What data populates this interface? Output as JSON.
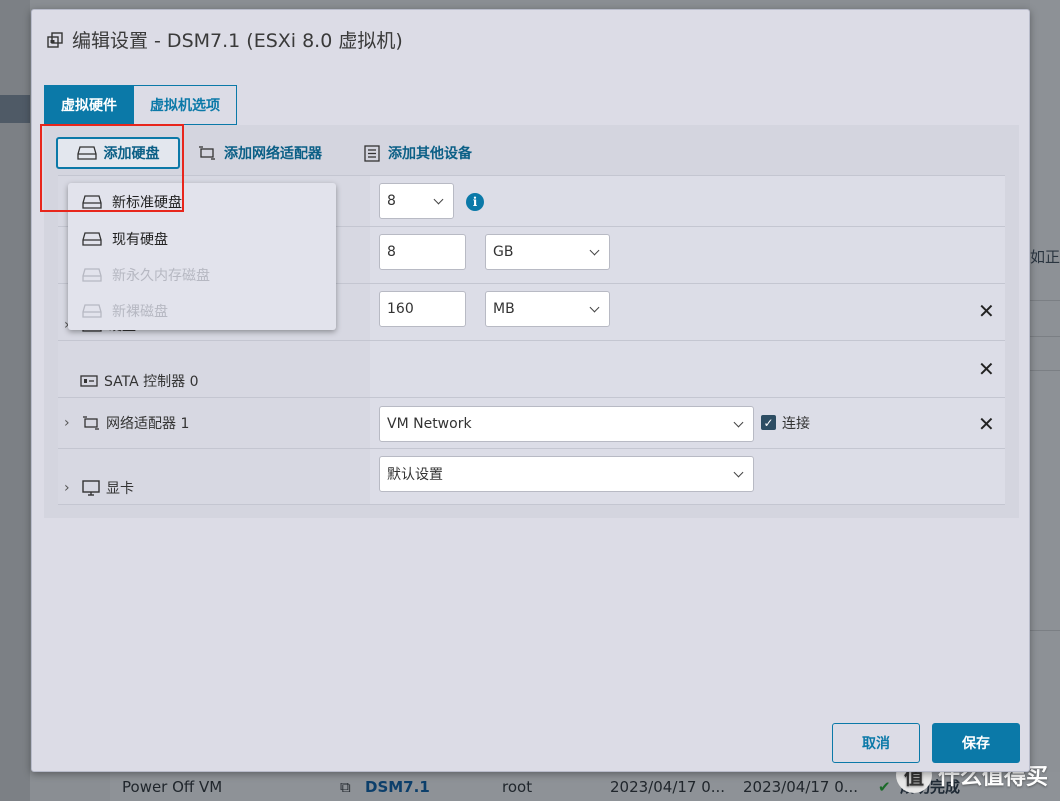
{
  "background": {
    "right_text": "如正",
    "bottom_row": {
      "action": "Power Off VM",
      "target": "DSM7.1",
      "user": "root",
      "time1": "2023/04/17 0...",
      "time2": "2023/04/17 0...",
      "status": "成功完成"
    },
    "watermark": "什么值得买",
    "watermark_badge": "值"
  },
  "modal": {
    "title": "编辑设置 - DSM7.1 (ESXi 8.0 虚拟机)",
    "tabs": [
      "虚拟硬件",
      "虚拟机选项"
    ],
    "toolbar": {
      "add_disk": "添加硬盘",
      "add_network": "添加网络适配器",
      "add_other": "添加其他设备"
    },
    "dropdown": {
      "items": [
        {
          "label": "新标准硬盘",
          "disabled": false
        },
        {
          "label": "现有硬盘",
          "disabled": false
        },
        {
          "label": "新永久内存磁盘",
          "disabled": true
        },
        {
          "label": "新裸磁盘",
          "disabled": true
        }
      ]
    },
    "rows": {
      "cpu": {
        "value": "8"
      },
      "memory": {
        "value": "8",
        "unit": "GB"
      },
      "disk": {
        "label": "硬盘 1",
        "value": "160",
        "unit": "MB"
      },
      "sata": {
        "label": "SATA 控制器 0"
      },
      "network": {
        "label": "网络适配器 1",
        "value": "VM Network",
        "connect_label": "连接",
        "connected": true
      },
      "display": {
        "label": "显卡",
        "value": "默认设置"
      }
    },
    "footer": {
      "cancel": "取消",
      "save": "保存"
    }
  },
  "colors": {
    "accent": "#0b79a8",
    "highlight": "#e8261c"
  }
}
